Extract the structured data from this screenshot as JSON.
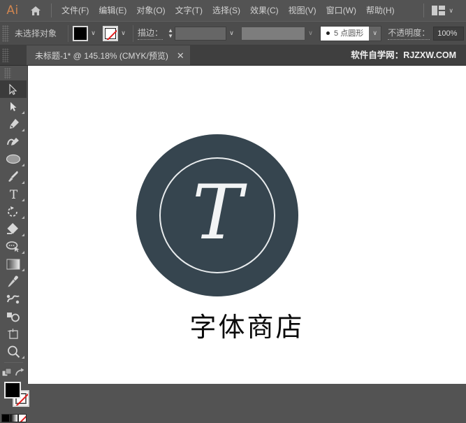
{
  "app": {
    "name": "Ai",
    "home_icon": "home-icon",
    "workspace_icon": "workspace-layout-icon",
    "workspace_chevron": "∨"
  },
  "menubar": {
    "items": [
      {
        "label": "文件(F)"
      },
      {
        "label": "编辑(E)"
      },
      {
        "label": "对象(O)"
      },
      {
        "label": "文字(T)"
      },
      {
        "label": "选择(S)"
      },
      {
        "label": "效果(C)"
      },
      {
        "label": "视图(V)"
      },
      {
        "label": "窗口(W)"
      },
      {
        "label": "帮助(H)"
      }
    ]
  },
  "controlbar": {
    "selection_status": "未选择对象",
    "fill_swatch": {
      "name": "fill-color-swatch",
      "color": "#000000"
    },
    "fill_dropdown_arrow": "∨",
    "stroke_swatch": {
      "name": "stroke-color-swatch",
      "color": "none",
      "slash_color": "#e41e1e"
    },
    "stroke_dropdown_arrow": "∨",
    "stroke_label": "描边：",
    "stroke_weight_value": "",
    "stroke_weight_arrow": "∨",
    "stroke_profile_value": "",
    "stroke_profile_arrow": "∨",
    "brush_value": "5 点圆形",
    "brush_arrow": "∨",
    "opacity_label": "不透明度：",
    "opacity_value": "100%"
  },
  "tabbar": {
    "document_title": "未标题-1* @ 145.18% (CMYK/预览)",
    "close_glyph": "✕",
    "watermark": "软件自学网：RJZXW.COM"
  },
  "toolbar": {
    "tools": [
      {
        "name": "selection-tool",
        "selected": true,
        "has_flyout": false
      },
      {
        "name": "direct-selection-tool",
        "selected": false,
        "has_flyout": true
      },
      {
        "name": "pen-tool",
        "selected": false,
        "has_flyout": true
      },
      {
        "name": "curvature-tool",
        "selected": false,
        "has_flyout": false
      },
      {
        "name": "ellipse-shape-tool",
        "selected": false,
        "has_flyout": true
      },
      {
        "name": "paintbrush-tool",
        "selected": false,
        "has_flyout": true
      },
      {
        "name": "type-tool",
        "selected": false,
        "has_flyout": true
      },
      {
        "name": "rotate-tool",
        "selected": false,
        "has_flyout": true
      },
      {
        "name": "shape-builder-tool",
        "selected": false,
        "has_flyout": true
      },
      {
        "name": "lasso-tool",
        "selected": false,
        "has_flyout": true
      },
      {
        "name": "gradient-tool",
        "selected": false,
        "has_flyout": true
      },
      {
        "name": "eyedropper-tool",
        "selected": false,
        "has_flyout": false
      },
      {
        "name": "blend-tool",
        "selected": false,
        "has_flyout": false
      },
      {
        "name": "symbol-sprayer-tool",
        "selected": false,
        "has_flyout": false
      },
      {
        "name": "artboard-tool",
        "selected": false,
        "has_flyout": false
      },
      {
        "name": "zoom-tool",
        "selected": false,
        "has_flyout": true
      }
    ],
    "arrange_icon": "arrange-objects-icon",
    "swap-icon": "swap-fill-stroke-icon",
    "fill_color": "#000000",
    "stroke_color": "none",
    "mini_swatches": [
      "black",
      "gradient",
      "none"
    ]
  },
  "artwork": {
    "circle_color": "#36454f",
    "ring_color": "#e9ecee",
    "letter": "T",
    "letter_color": "#f2f4f5",
    "brand_text": "字体商店",
    "brand_color": "#0b0b0b",
    "canvas_background": "#ffffff"
  }
}
